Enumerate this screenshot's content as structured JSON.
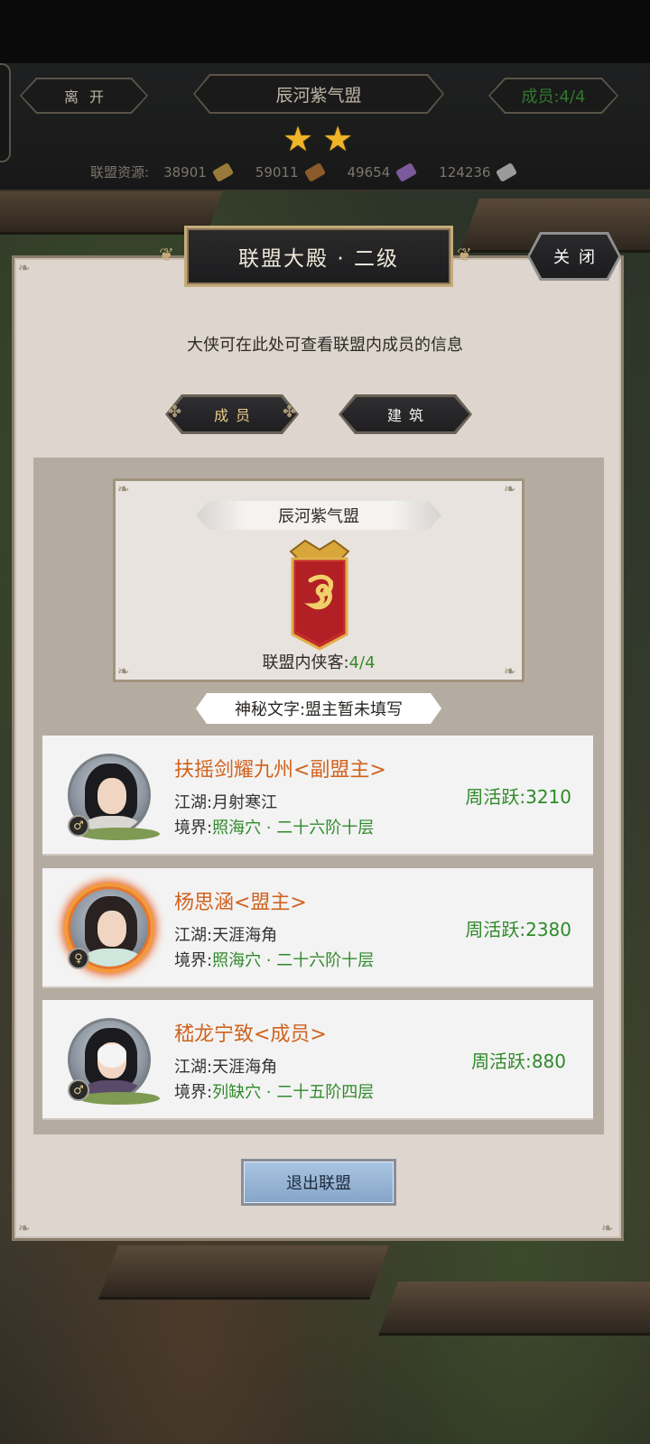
{
  "header": {
    "leave_label": "离开",
    "alliance_title": "辰河紫气盟",
    "members_label": "成员:4/4",
    "stars": [
      "★",
      "★"
    ],
    "resources_label": "联盟资源:",
    "resources": [
      {
        "value": "38901",
        "icon": "wood-icon",
        "color": "#9a7a3a"
      },
      {
        "value": "59011",
        "icon": "bronze-icon",
        "color": "#8a5a2a"
      },
      {
        "value": "49654",
        "icon": "crystal-icon",
        "color": "#7a5a9a"
      },
      {
        "value": "124236",
        "icon": "silver-icon",
        "color": "#9a9a9a"
      }
    ]
  },
  "panel": {
    "title": "联盟大殿 · 二级",
    "close_label": "关闭",
    "description": "大侠可在此处可查看联盟内成员的信息",
    "tabs": [
      {
        "label": "成员",
        "active": true
      },
      {
        "label": "建筑",
        "active": false
      }
    ],
    "alliance": {
      "name": "辰河紫气盟",
      "member_count_label": "联盟内侠客:",
      "member_count_value": "4/4",
      "motto": "神秘文字:盟主暂未填写"
    },
    "members": [
      {
        "name": "扶摇剑耀九州<副盟主>",
        "jianghu_label": "江湖:",
        "jianghu": "月射寒江",
        "realm_label": "境界:",
        "realm": "照海穴 · 二十六阶十层",
        "activity_label": "周活跃:",
        "activity": "3210",
        "gender": "♂",
        "avatar": "male-swordsman-avatar"
      },
      {
        "name": "杨思涵<盟主>",
        "jianghu_label": "江湖:",
        "jianghu": "天涯海角",
        "realm_label": "境界:",
        "realm": "照海穴 · 二十六阶十层",
        "activity_label": "周活跃:",
        "activity": "2380",
        "gender": "♀",
        "avatar": "female-avatar"
      },
      {
        "name": "嵇龙宁致<成员>",
        "jianghu_label": "江湖:",
        "jianghu": "天涯海角",
        "realm_label": "境界:",
        "realm": "列缺穴 · 二十五阶四层",
        "activity_label": "周活跃:",
        "activity": "880",
        "gender": "♂",
        "avatar": "masked-avatar"
      }
    ],
    "quit_label": "退出联盟"
  },
  "colors": {
    "accent_orange": "#d1621e",
    "accent_green": "#2f8a2a",
    "gold": "#e8c98a"
  }
}
